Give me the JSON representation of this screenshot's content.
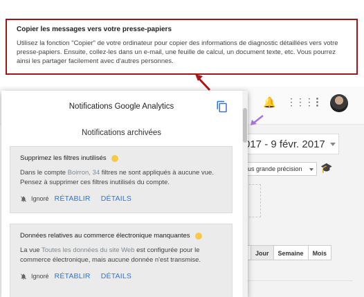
{
  "tooltip": {
    "title": "Copier les messages vers votre presse-papiers",
    "body": "Utilisez la fonction \"Copier\" de votre ordinateur pour copier des informations de diagnostic détaillées vers votre presse-papiers. Ensuite, collez-les dans un e-mail, une feuille de calcul, un document texte, etc. Vous pourrez ainsi les partager facilement avec d'autres personnes."
  },
  "panel": {
    "title": "Notifications Google Analytics",
    "archived_label": "Notifications archivées",
    "cards": [
      {
        "title": "Supprimez les filtres inutilisés",
        "text_before": "Dans le compte ",
        "account": "Boirron, 34",
        "text_after": " filtres ne sont appliqués à aucune vue. Pensez à supprimer ces filtres inutilisés du compte.",
        "status": "Ignoré",
        "restore": "RÉTABLIR",
        "details": "DÉTAILS"
      },
      {
        "title": "Données relatives au commerce électronique manquantes",
        "text_before": "La vue ",
        "account": "Toutes les données du site Web",
        "text_after": " est configurée pour le commerce électronique, mais aucune donnée n'est transmise.",
        "status": "Ignoré",
        "restore": "RÉTABLIR",
        "details": "DÉTAILS"
      }
    ]
  },
  "background": {
    "date_range": "017 - 9 févr. 2017",
    "precision": "lus grande précision",
    "periods": [
      "s",
      "Jour",
      "Semaine",
      "Mois"
    ]
  },
  "colors": {
    "tooltip_border": "#a31515",
    "link": "#2a74e0",
    "warning": "#f7c948",
    "accent_arrow": "#a873e0"
  }
}
